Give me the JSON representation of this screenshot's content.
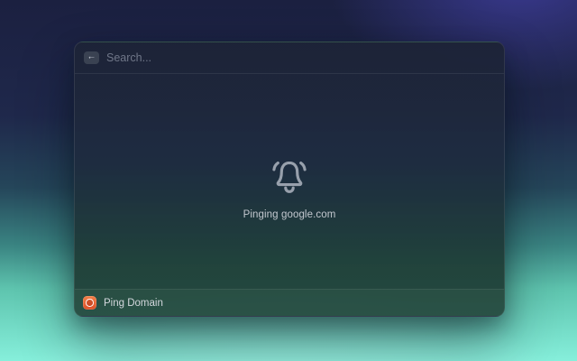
{
  "window": {
    "header": {
      "search_placeholder": "Search...",
      "search_value": ""
    },
    "main": {
      "status_text": "Pinging google.com"
    },
    "footer": {
      "command_label": "Ping Domain"
    }
  },
  "icons": {
    "back_arrow": "←",
    "bell": "bell-icon",
    "command": "ping-extension-icon"
  },
  "colors": {
    "accent_orange": "#e8632f",
    "background_navy": "#1c2140",
    "background_indigo": "#2d3173",
    "background_mint": "#87efdb",
    "window_dark": "#1e2337",
    "window_green": "#20423a",
    "bell_gray": "#98a0ac",
    "text_muted": "#6f7688",
    "text_primary": "#c3c8cf"
  }
}
